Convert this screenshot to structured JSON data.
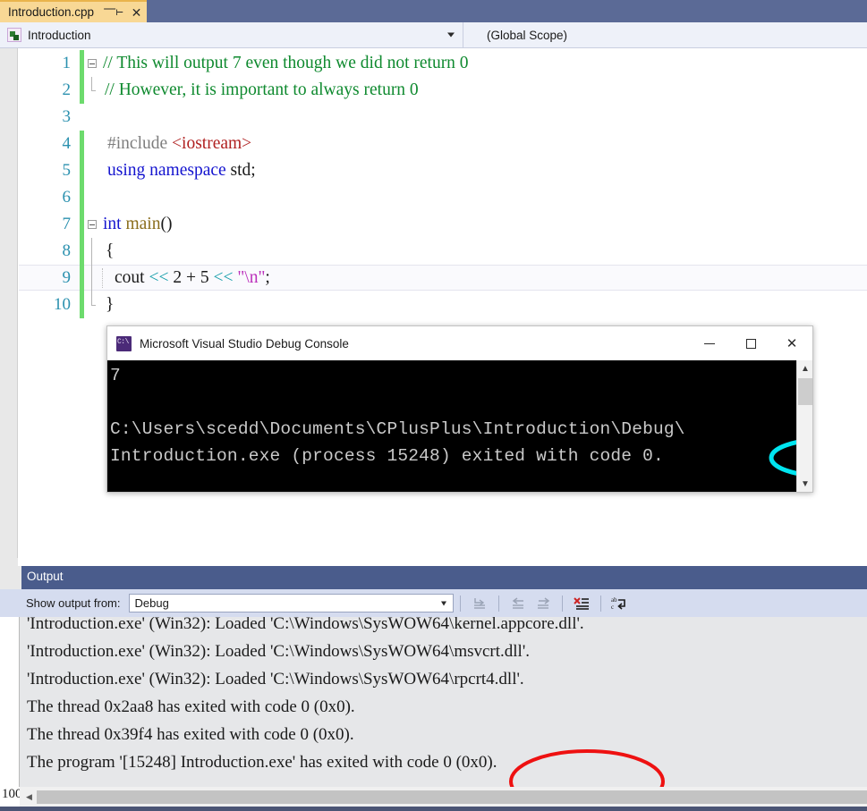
{
  "tab": {
    "title": "Introduction.cpp",
    "pin_icon": "pin-icon",
    "close_icon": "close-icon"
  },
  "navbar": {
    "member_value": "Introduction",
    "scope_value": "(Global Scope)",
    "project_icon": "project-icon",
    "dropdown_icon": "chevron-down-icon"
  },
  "editor": {
    "lines": [
      {
        "num": "1",
        "html": "<span class=\"c-comment\">// This will output 7 even though we did not return 0</span>"
      },
      {
        "num": "2",
        "html": "<span class=\"c-comment\">// However, it is important to always return 0</span>"
      },
      {
        "num": "3",
        "html": ""
      },
      {
        "num": "4",
        "html": "<span class=\"c-pre\">#include </span><span class=\"c-inc\">&lt;iostream&gt;</span>"
      },
      {
        "num": "5",
        "html": "<span class=\"c-kw\">using namespace</span><span class=\"c-plain\"> std;</span>"
      },
      {
        "num": "6",
        "html": ""
      },
      {
        "num": "7",
        "html": "<span class=\"c-type\">int </span><span class=\"c-fn\">main</span><span class=\"c-plain\">()</span>"
      },
      {
        "num": "8",
        "html": "<span class=\"c-plain\">{</span>"
      },
      {
        "num": "9",
        "html": "<span class=\"c-plain\">cout </span><span class=\"c-op\">&lt;&lt; </span><span class=\"c-plain\">2 + 5 </span><span class=\"c-op\">&lt;&lt; </span><span class=\"c-str\">\"\\n\"</span><span class=\"c-plain\">;</span>"
      },
      {
        "num": "10",
        "html": "<span class=\"c-plain\">}</span>"
      }
    ],
    "plain_lines": [
      "// This will output 7 even though we did not return 0",
      "// However, it is important to always return 0",
      "",
      "#include <iostream>",
      "using namespace std;",
      "",
      "int main()",
      "{",
      "    cout << 2 + 5 << \"\\n\";",
      "}"
    ],
    "current_line": 9
  },
  "console": {
    "title": "Microsoft Visual Studio Debug Console",
    "app_icon": "console-app-icon",
    "minimize_label": "─",
    "maximize_label": "□",
    "close_label": "✕",
    "output_line_1": "7",
    "output_line_2": "",
    "output_line_3": "C:\\Users\\scedd\\Documents\\CPlusPlus\\Introduction\\Debug\\",
    "output_line_4": "Introduction.exe (process 15248) exited with code 0.",
    "scroll_up_icon": "chevron-up-icon",
    "scroll_down_icon": "chevron-down-icon"
  },
  "annotations": {
    "cyan_ellipse_label": "code 0.",
    "cyan_color": "#00e5f0",
    "red_ellipse_label": "code 0 (0x0).",
    "red_color": "#ee1111"
  },
  "output_panel": {
    "title": "Output",
    "show_output_from_label": "Show output from:",
    "selected_source": "Debug",
    "dropdown_icon": "chevron-down-icon",
    "toolbar_buttons": [
      {
        "name": "find-message-in-code-icon",
        "glyph": "⤵"
      },
      {
        "name": "go-to-previous-message-icon",
        "glyph": "⇦"
      },
      {
        "name": "go-to-next-message-icon",
        "glyph": "⇨"
      },
      {
        "name": "clear-all-icon",
        "glyph": "✕"
      },
      {
        "name": "toggle-word-wrap-icon",
        "glyph": "ab"
      }
    ],
    "lines": [
      "'Introduction.exe' (Win32): Loaded 'C:\\Windows\\SysWOW64\\kernel.appcore.dll'.",
      "'Introduction.exe' (Win32): Loaded 'C:\\Windows\\SysWOW64\\msvcrt.dll'.",
      "'Introduction.exe' (Win32): Loaded 'C:\\Windows\\SysWOW64\\rpcrt4.dll'.",
      "The thread 0x2aa8 has exited with code 0 (0x0).",
      "The thread 0x39f4 has exited with code 0 (0x0).",
      "The program '[15248] Introduction.exe' has exited with code 0 (0x0)."
    ],
    "footer_number": "100",
    "scroll_left_icon": "triangle-left-icon",
    "scroll_right_icon": "triangle-right-icon"
  },
  "colors": {
    "tab_active_bg": "#f8d895",
    "tabstrip_bg": "#5b6a96",
    "output_header_bg": "#4a5c8c",
    "output_toolbar_bg": "#d5dcef",
    "comment_green": "#0f8a2f",
    "keyword_blue": "#1414cf",
    "string_magenta": "#bb2fbb",
    "operator_teal": "#0f9ba8",
    "include_red": "#b02020",
    "line_number_blue": "#2b91af",
    "change_bar_green": "#6ddb6d"
  }
}
